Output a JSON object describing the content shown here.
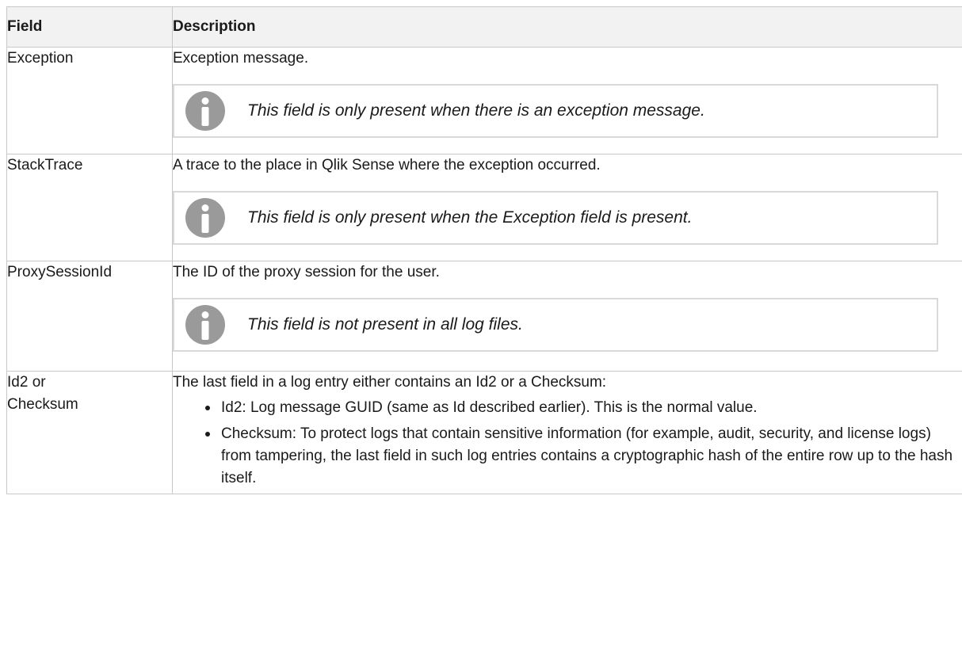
{
  "table": {
    "headers": {
      "field": "Field",
      "description": "Description"
    },
    "rows": [
      {
        "field": "Exception",
        "description": "Exception message.",
        "note": "This field is only present when there is an exception message."
      },
      {
        "field": "StackTrace",
        "description": "A trace to the place in Qlik Sense where the exception occurred.",
        "note": "This field is only present when the Exception field is present."
      },
      {
        "field": "ProxySessionId",
        "description": "The ID of the proxy session for the user.",
        "note": "This field is not present in all log files."
      },
      {
        "field_line1": "Id2 or",
        "field_line2": "Checksum",
        "description": "The last field in a log entry either contains an Id2 or a Checksum:",
        "items": [
          "Id2: Log message GUID (same as Id described earlier). This is the normal value.",
          "Checksum: To protect logs that contain sensitive information (for example, audit, security, and license logs) from tampering, the last field in such log entries contains a cryptographic hash of the entire row up to the hash itself."
        ]
      }
    ]
  },
  "icons": {
    "note": "info-icon"
  },
  "colors": {
    "header_bg": "#f2f2f2",
    "border": "#c8c8c8",
    "note_border": "#d9d9d9",
    "icon": "#9a9a9a"
  }
}
